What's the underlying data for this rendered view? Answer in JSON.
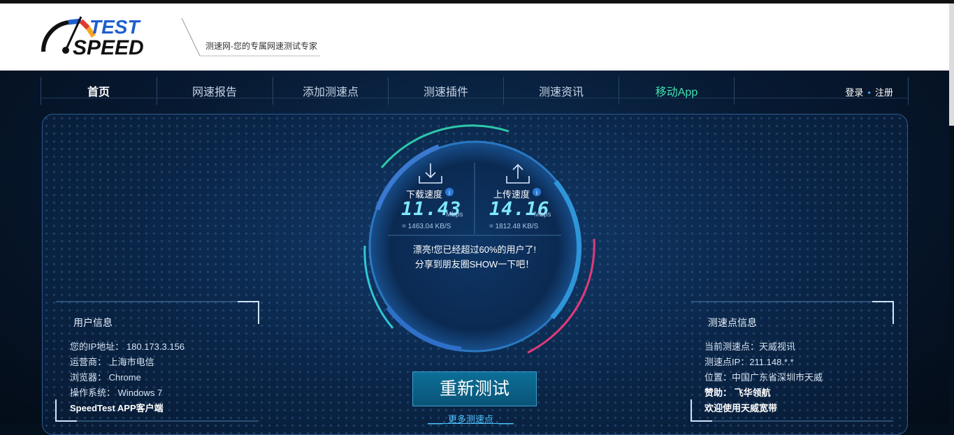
{
  "header": {
    "logo_top": "TEST",
    "logo_bottom": "SPEED",
    "slogan": "测速网-您的专属网速测试专家"
  },
  "nav": {
    "items": [
      {
        "label": "首页"
      },
      {
        "label": "网速报告"
      },
      {
        "label": "添加测速点"
      },
      {
        "label": "测速插件"
      },
      {
        "label": "测速资讯"
      },
      {
        "label": "移动App"
      }
    ],
    "login": "登录",
    "separator": "•",
    "register": "注册"
  },
  "gauge": {
    "download": {
      "label": "下载速度",
      "value": "11.43",
      "unit": "Mbps",
      "kbs": "= 1463.04  KB/S"
    },
    "upload": {
      "label": "上传速度",
      "value": "14.16",
      "unit": "Mbps",
      "kbs": "= 1812.48  KB/S"
    },
    "message_line1": "漂亮!您已经超过60%的用户了!",
    "message_line2": "分享到朋友圈SHOW一下吧！"
  },
  "user_info": {
    "title": "用户信息",
    "ip": "您的IP地址： 180.173.3.156",
    "isp": "运营商： 上海市电信",
    "browser": "浏览器： Chrome",
    "os": "操作系统： Windows 7",
    "app_link": "SpeedTest APP客户端"
  },
  "node_info": {
    "title": "测速点信息",
    "current": "当前测速点：天威视讯",
    "node_ip": "测速点IP：211.148.*.*",
    "location": "位置：中国广东省深圳市天威",
    "sponsor": "赞助： 飞华领航",
    "welcome": "欢迎使用天威宽带"
  },
  "actions": {
    "retest": "重新测试",
    "more_nodes": "___. 更多测速点 .___"
  },
  "colors": {
    "accent": "#3fe0b0",
    "digits": "#7fe8ff",
    "arc_pink": "#e23a7a",
    "arc_cyan": "#2ec7d8"
  }
}
